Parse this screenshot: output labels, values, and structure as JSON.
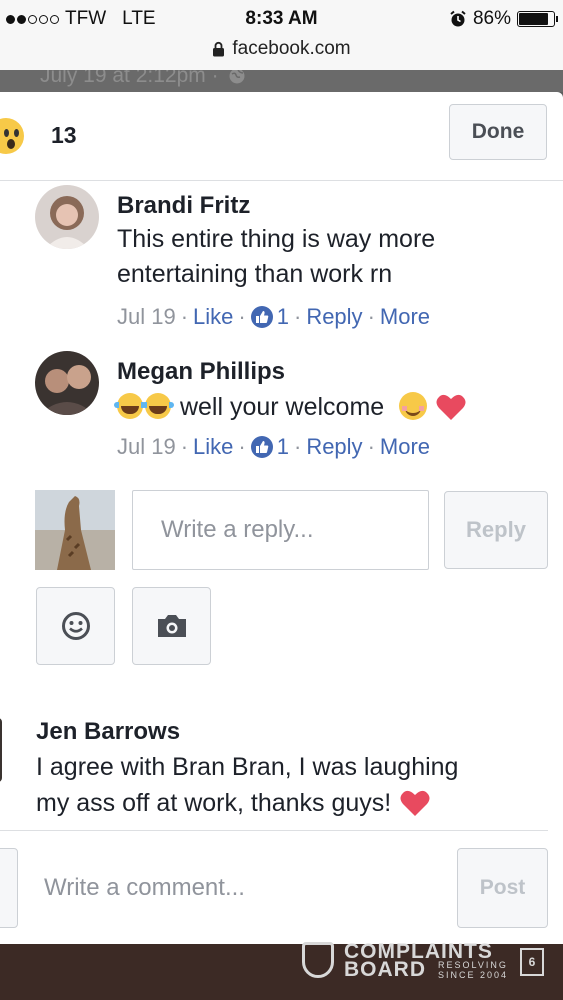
{
  "status_bar": {
    "carrier": "TFW",
    "network": "LTE",
    "time": "8:33 AM",
    "battery": "86%",
    "battery_level": 0.86,
    "signal_bars_filled": 2,
    "signal_bars_total": 5
  },
  "browser": {
    "url": "facebook.com",
    "lock_icon": "lock-icon"
  },
  "backdrop": {
    "post_time": "July 19 at 2:12pm ·"
  },
  "header": {
    "reaction_count": "13",
    "done_label": "Done",
    "reaction_icon": "wow-emoji-icon"
  },
  "comments": [
    {
      "author": "Brandi Fritz",
      "lines": [
        "This entire thing is way more",
        "entertaining than work rn"
      ],
      "date": "Jul 19",
      "like_label": "Like",
      "like_count": "1",
      "reply_label": "Reply",
      "more_label": "More"
    },
    {
      "author": "Megan Phillips",
      "text": "well your welcome",
      "date": "Jul 19",
      "like_label": "Like",
      "like_count": "1",
      "reply_label": "Reply",
      "more_label": "More"
    },
    {
      "author": "Jen Barrows",
      "lines": [
        "I agree with Bran Bran, I was laughing",
        "my ass off at work, thanks guys!"
      ]
    }
  ],
  "reply_box": {
    "placeholder": "Write a reply...",
    "reply_label": "Reply"
  },
  "comment_box": {
    "placeholder": "Write a comment...",
    "post_label": "Post"
  },
  "watermark": {
    "line1": "COMPLAINTS",
    "line2": "BOARD",
    "tag1": "RESOLVING",
    "tag2": "SINCE 2004",
    "badge": "6"
  },
  "colors": {
    "facebook_blue": "#4267b2",
    "meta_gray": "#90949c",
    "heart_red": "#e84a5f"
  }
}
